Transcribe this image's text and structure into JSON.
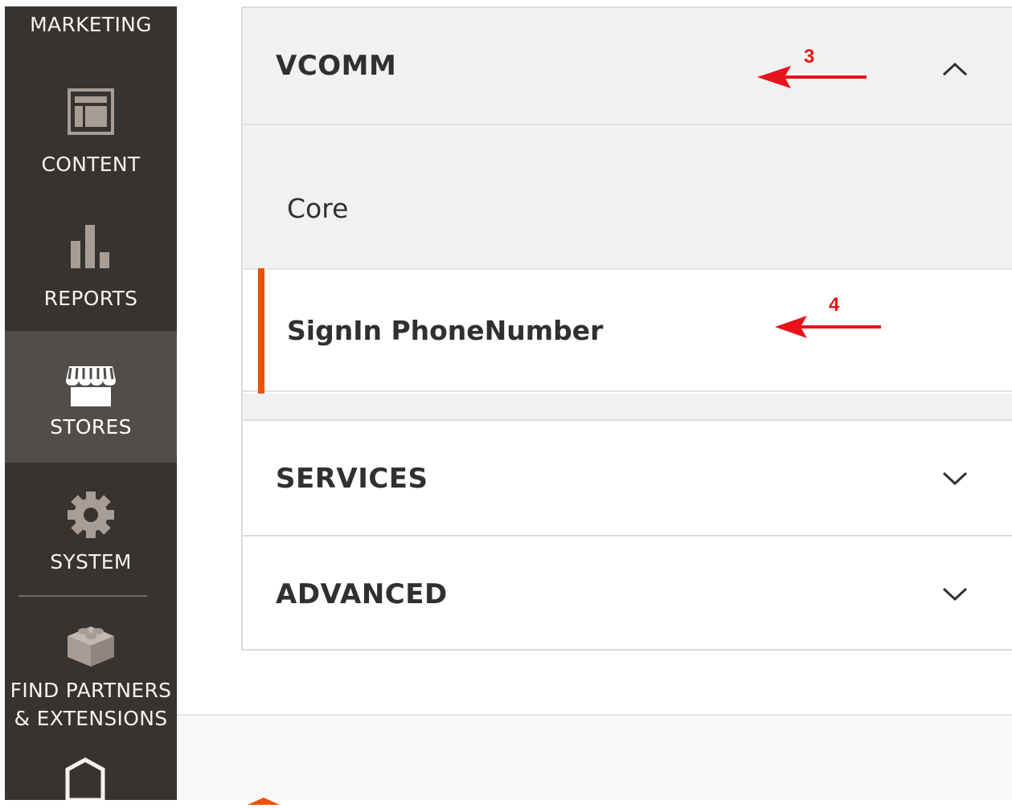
{
  "sidebar": {
    "items": [
      {
        "label": "MARKETING",
        "icon": "megaphone-icon"
      },
      {
        "label": "CONTENT",
        "icon": "layout-icon"
      },
      {
        "label": "REPORTS",
        "icon": "bar-chart-icon"
      },
      {
        "label": "STORES",
        "icon": "storefront-icon",
        "active": true
      },
      {
        "label": "SYSTEM",
        "icon": "gear-icon"
      },
      {
        "label": "FIND PARTNERS\n& EXTENSIONS",
        "icon": "blocks-icon"
      }
    ]
  },
  "config": {
    "sections": [
      {
        "title": "VCOMM",
        "expanded": true,
        "chevron": "chevron-up-icon",
        "items": [
          {
            "label": "Core",
            "active": false
          },
          {
            "label": "SignIn PhoneNumber",
            "active": true
          }
        ]
      },
      {
        "title": "SERVICES",
        "expanded": false,
        "chevron": "chevron-down-icon"
      },
      {
        "title": "ADVANCED",
        "expanded": false,
        "chevron": "chevron-down-icon"
      }
    ]
  },
  "annotations": [
    {
      "number": "3",
      "points_to": "VCOMM"
    },
    {
      "number": "4",
      "points_to": "SignIn PhoneNumber"
    }
  ],
  "colors": {
    "sidebar_bg": "#373330",
    "sidebar_active_bg": "#524d49",
    "accent_orange": "#eb5202",
    "annotation_red": "#e8131a",
    "submenu_bg": "#f1f1f1"
  }
}
